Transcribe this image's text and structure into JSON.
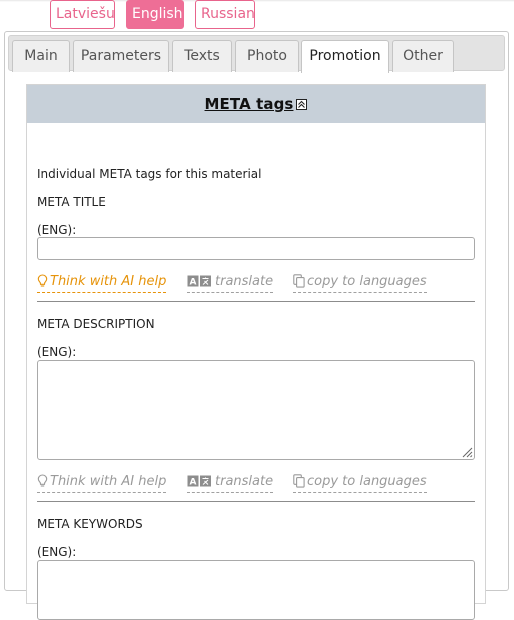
{
  "languages": [
    {
      "label": "Latviešu",
      "active": false
    },
    {
      "label": "English",
      "active": true
    },
    {
      "label": "Russian",
      "active": false
    }
  ],
  "tabs": [
    {
      "label": "Main",
      "active": false
    },
    {
      "label": "Parameters",
      "active": false
    },
    {
      "label": "Texts",
      "active": false
    },
    {
      "label": "Photo",
      "active": false
    },
    {
      "label": "Promotion",
      "active": true
    },
    {
      "label": "Other",
      "active": false
    }
  ],
  "section": {
    "title": "META tags",
    "intro": "Individual META tags for this material"
  },
  "fields": {
    "meta_title": {
      "label": "META TITLE",
      "lang_label": "(ENG):",
      "value": ""
    },
    "meta_description": {
      "label": "META DESCRIPTION",
      "lang_label": "(ENG):",
      "value": ""
    },
    "meta_keywords": {
      "label": "META KEYWORDS",
      "lang_label": "(ENG):",
      "value": ""
    }
  },
  "tools": {
    "ai_help": "Think with AI help",
    "translate": "translate",
    "copy": "copy to languages"
  },
  "colors": {
    "accent_pink": "#ee6e96",
    "section_header": "#c7d0d9",
    "ai_active": "#e6930a",
    "tool_muted": "#9a9a9a"
  }
}
